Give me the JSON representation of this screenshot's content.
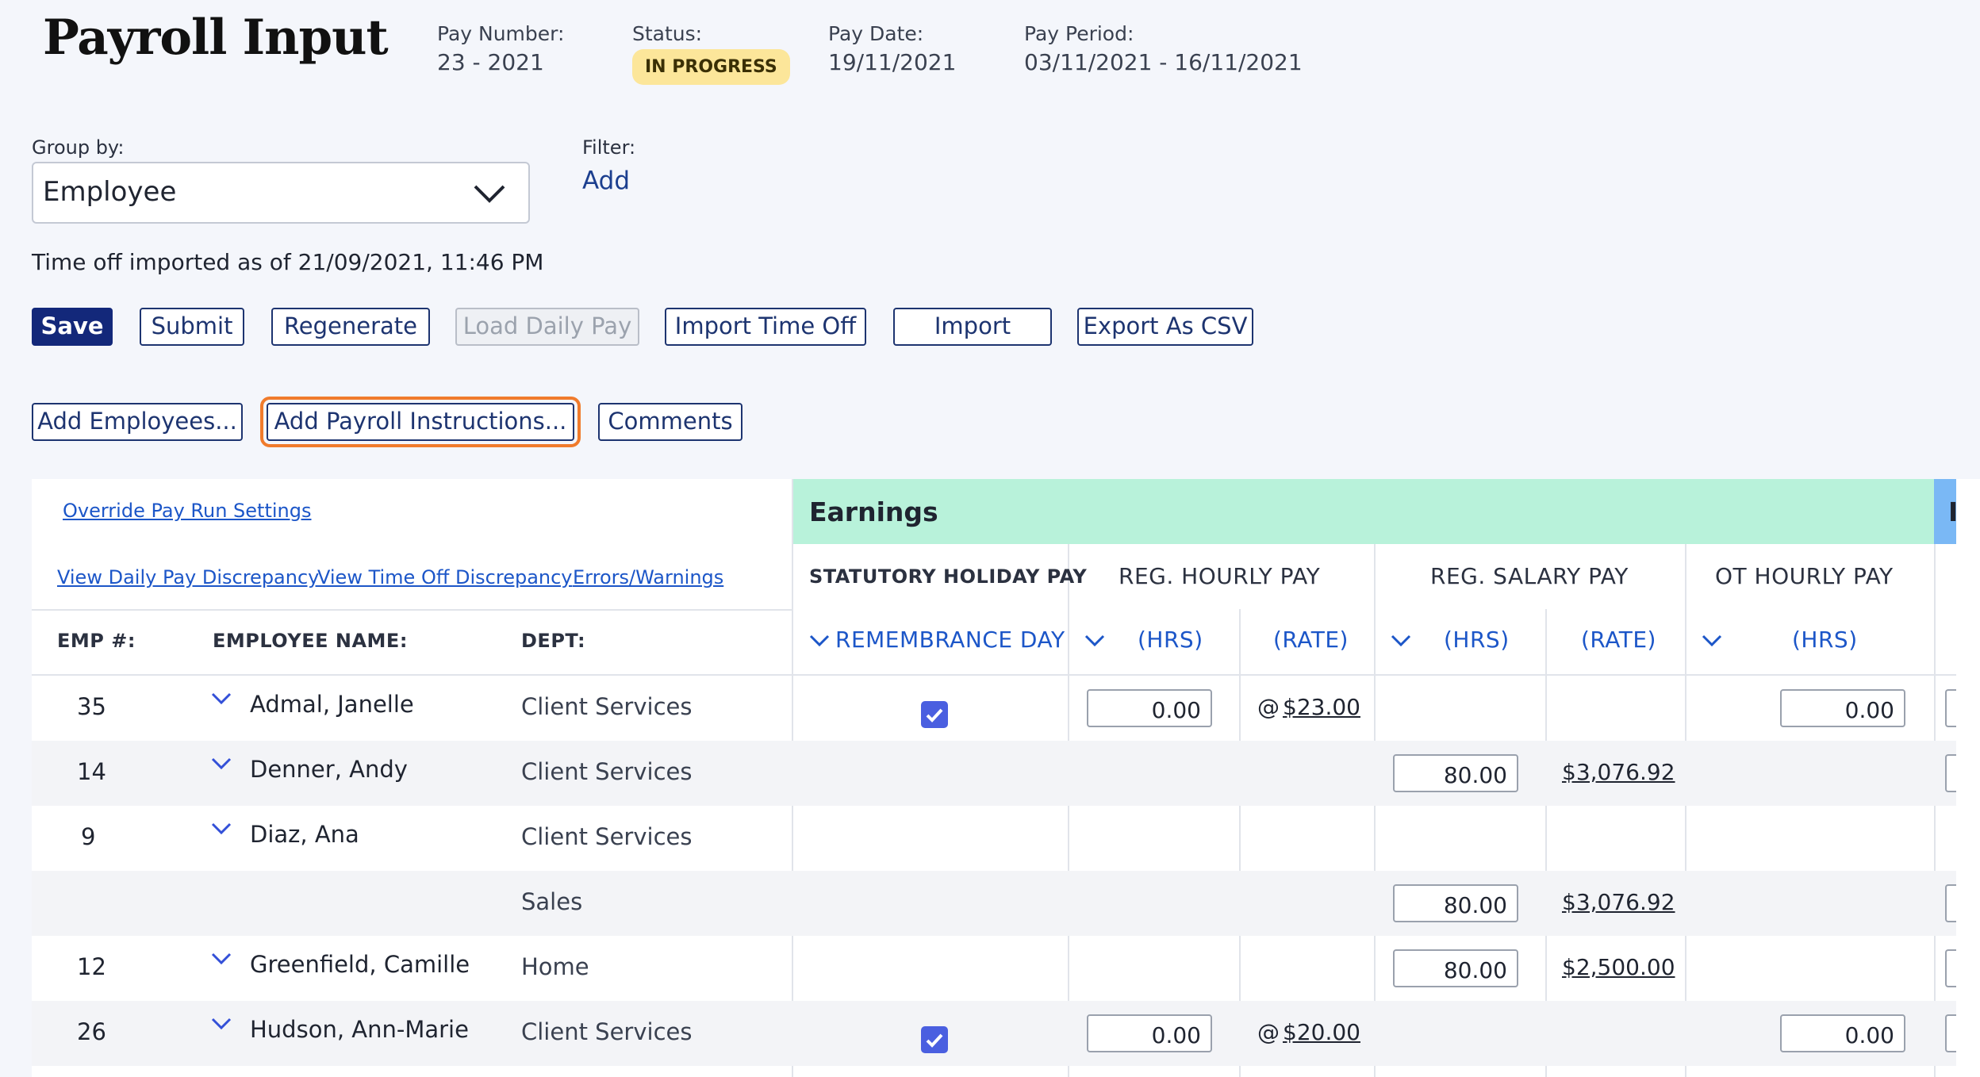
{
  "header": {
    "title": "Payroll Input",
    "pay_number_label": "Pay Number:",
    "pay_number": "23 - 2021",
    "status_label": "Status:",
    "status": "IN PROGRESS",
    "pay_date_label": "Pay Date:",
    "pay_date": "19/11/2021",
    "pay_period_label": "Pay Period:",
    "pay_period": "03/11/2021 - 16/11/2021"
  },
  "controls": {
    "group_by_label": "Group by:",
    "group_by_value": "Employee",
    "filter_label": "Filter:",
    "filter_add": "Add",
    "time_off_note": "Time off imported as of 21/09/2021, 11:46 PM"
  },
  "toolbar": {
    "save": "Save",
    "submit": "Submit",
    "regenerate": "Regenerate",
    "load_daily_pay": "Load Daily Pay",
    "import_time_off": "Import Time Off",
    "import": "Import",
    "export_csv": "Export As CSV",
    "add_employees": "Add Employees...",
    "add_payroll_instructions": "Add Payroll Instructions...",
    "comments": "Comments"
  },
  "links": {
    "override": "Override Pay Run Settings",
    "daily_pay_discrepancy": "View Daily Pay Discrepancy",
    "time_off_discrepancy": "View Time Off Discrepancy",
    "errors_warnings": "Errors/Warnings"
  },
  "table": {
    "section_earnings": "Earnings",
    "next_section_partial": "I",
    "col_emp": "EMP #:",
    "col_name": "EMPLOYEE NAME:",
    "col_dept": "DEPT:",
    "col_stat_holiday": "STATUTORY HOLIDAY PAY",
    "col_reg_hourly": "REG. HOURLY PAY",
    "col_reg_salary": "REG. SALARY PAY",
    "col_ot_hourly": "OT HOURLY PAY",
    "sub_remembrance": "REMEMBRANCE DAY",
    "sub_hrs": "(HRS)",
    "sub_rate": "(RATE)",
    "at_sign": "@",
    "rows": [
      {
        "emp": "35",
        "name": "Admal, Janelle",
        "dept": "Client Services",
        "stat_checked": true,
        "hourly_hrs": "0.00",
        "hourly_rate": "$23.00",
        "salary_hrs": "",
        "salary_rate": "",
        "ot_hrs": "0.00"
      },
      {
        "emp": "14",
        "name": "Denner, Andy",
        "dept": "Client Services",
        "stat_checked": false,
        "hourly_hrs": "",
        "hourly_rate": "",
        "salary_hrs": "80.00",
        "salary_rate": "$3,076.92",
        "ot_hrs": ""
      },
      {
        "emp": "9",
        "name": "Diaz, Ana",
        "dept": "Client Services",
        "stat_checked": false,
        "hourly_hrs": "",
        "hourly_rate": "",
        "salary_hrs": "",
        "salary_rate": "",
        "ot_hrs": ""
      },
      {
        "emp": "",
        "name": "",
        "dept": "Sales",
        "stat_checked": false,
        "hourly_hrs": "",
        "hourly_rate": "",
        "salary_hrs": "80.00",
        "salary_rate": "$3,076.92",
        "ot_hrs": ""
      },
      {
        "emp": "12",
        "name": "Greenfield, Camille",
        "dept": "Home",
        "stat_checked": false,
        "hourly_hrs": "",
        "hourly_rate": "",
        "salary_hrs": "80.00",
        "salary_rate": "$2,500.00",
        "ot_hrs": ""
      },
      {
        "emp": "26",
        "name": "Hudson, Ann-Marie",
        "dept": "Client Services",
        "stat_checked": true,
        "hourly_hrs": "0.00",
        "hourly_rate": "$20.00",
        "salary_hrs": "",
        "salary_rate": "",
        "ot_hrs": "0.00"
      }
    ]
  }
}
